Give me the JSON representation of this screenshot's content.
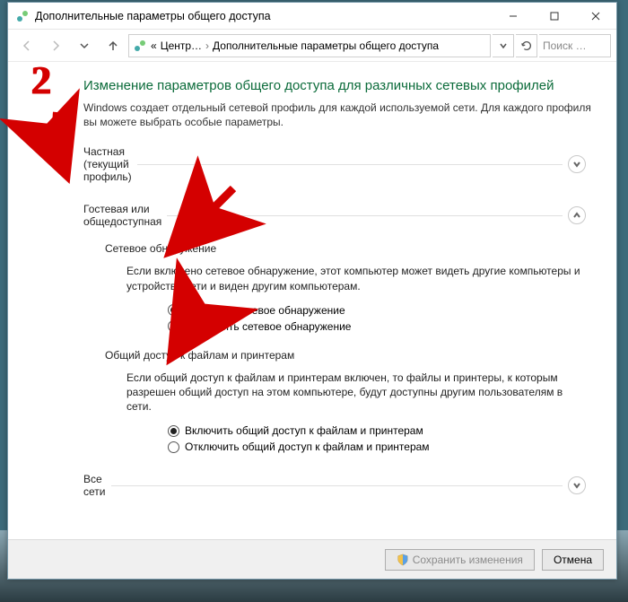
{
  "window": {
    "title": "Дополнительные параметры общего доступа"
  },
  "nav": {
    "crumb1": "Центр…",
    "crumb2": "Дополнительные параметры общего доступа",
    "search_placeholder": "Поиск …"
  },
  "annotation": {
    "number": "2"
  },
  "main": {
    "heading": "Изменение параметров общего доступа для различных сетевых профилей",
    "subtext": "Windows создает отдельный сетевой профиль для каждой используемой сети. Для каждого профиля вы можете выбрать особые параметры.",
    "sections": {
      "private": {
        "label": "Частная (текущий профиль)"
      },
      "guest": {
        "label": "Гостевая или общедоступная"
      },
      "all": {
        "label": "Все сети"
      }
    },
    "guest": {
      "discovery": {
        "title": "Сетевое обнаружение",
        "desc": "Если включено сетевое обнаружение, этот компьютер может видеть другие компьютеры и устройства сети и виден другим компьютерам.",
        "on": "Включить сетевое обнаружение",
        "off": "Отключить сетевое обнаружение"
      },
      "fileshare": {
        "title": "Общий доступ к файлам и принтерам",
        "desc": "Если общий доступ к файлам и принтерам включен, то файлы и принтеры, к которым разрешен общий доступ на этом компьютере, будут доступны другим пользователям в сети.",
        "on": "Включить общий доступ к файлам и принтерам",
        "off": "Отключить общий доступ к файлам и принтерам"
      }
    }
  },
  "footer": {
    "save": "Сохранить изменения",
    "cancel": "Отмена"
  }
}
